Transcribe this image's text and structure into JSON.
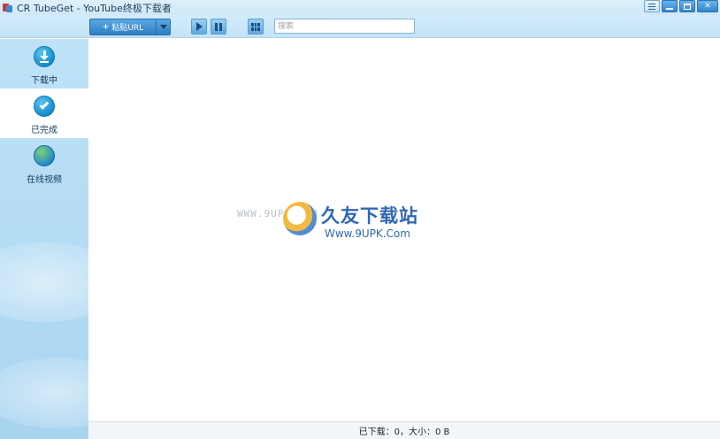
{
  "window": {
    "title": "CR TubeGet - YouTube终极下载者"
  },
  "toolbar": {
    "paste_url_label": "粘贴URL",
    "paste_plus": "+",
    "search_placeholder": "搜索"
  },
  "sidebar": {
    "items": [
      {
        "label": "下载中",
        "icon": "download-icon",
        "active": false
      },
      {
        "label": "已完成",
        "icon": "check-icon",
        "active": true
      },
      {
        "label": "在线视频",
        "icon": "globe-icon",
        "active": false
      }
    ]
  },
  "watermark": {
    "faint_url": "WWW.9UPK.COM",
    "title": "久友下载站",
    "url": "Www.9UPK.Com"
  },
  "status": {
    "text": "已下载：0，大小：0 B"
  },
  "colors": {
    "accent": "#2f7ec4",
    "sidebar_bg": "#b3dbf4",
    "toolbar_bg": "#c3e3f7",
    "watermark": "#2e67b5"
  }
}
